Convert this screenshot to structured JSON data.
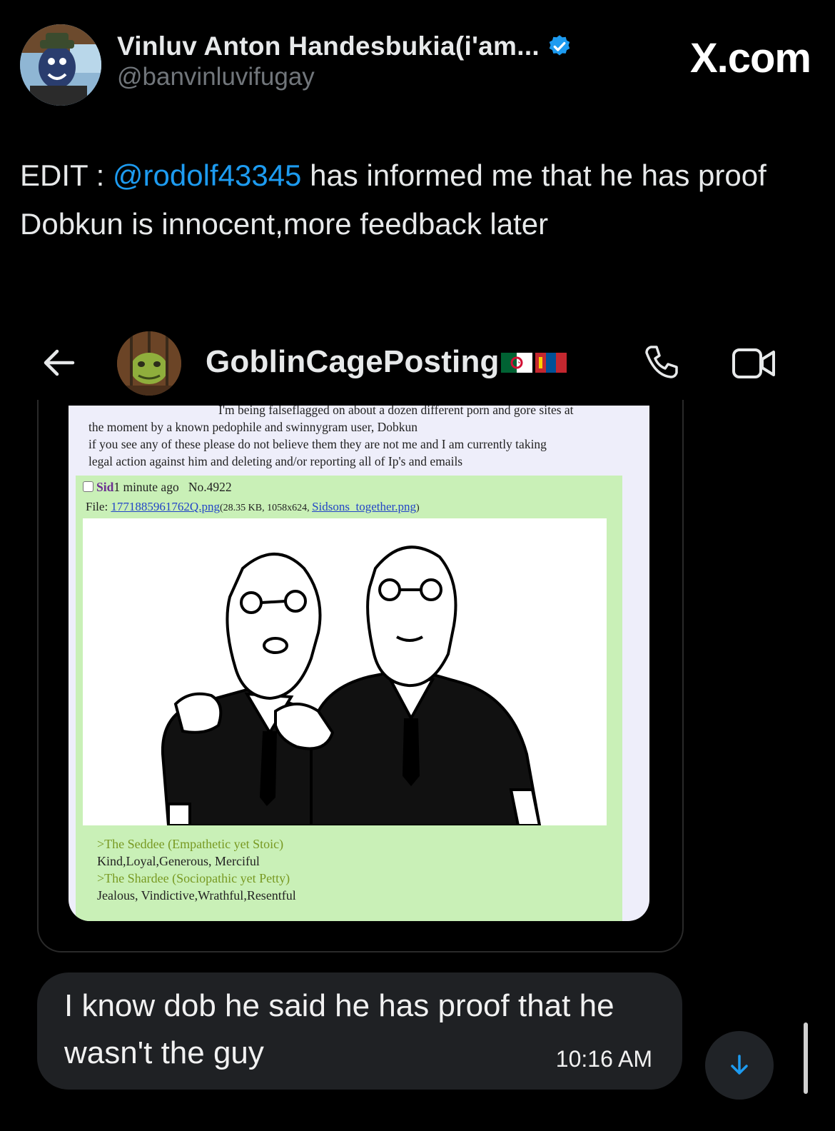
{
  "tweet": {
    "display_name": "Vinluv Anton Handesbukia(i'am...",
    "handle": "@banvinluvifugay",
    "source": "X.com",
    "text_prefix": "EDIT : ",
    "mention": "@rodolf43345",
    "text_suffix": " has informed me that he has proof Dobkun is innocent,more feedback later"
  },
  "chat": {
    "contact_name": "GoblinCagePosting",
    "flags": [
      "algeria-flag",
      "mongolia-flag"
    ],
    "icons": {
      "back": "back-arrow-icon",
      "call": "phone-icon",
      "video": "video-icon",
      "scroll": "arrow-down-icon"
    }
  },
  "screenshot": {
    "op_lines": [
      "I'm being falseflagged on about a dozen different porn and gore sites at",
      "the moment by a known pedophile and swinnygram user, Dobkun",
      "if you see any of these please do not believe them they are not me and I am currently taking",
      "legal action against him and deleting and/or reporting all of Ip's and emails"
    ],
    "reply": {
      "name": "Sid",
      "time": "1 minute ago",
      "number": "No.4922",
      "file_label": "File: ",
      "file_name": "1771885961762Q.png",
      "file_meta": "(28.35 KB, 1058x624, ",
      "original_name": "Sidsons_together.png",
      "file_close": ")",
      "greentext": [
        ">The Seddee (Empathetic yet Stoic)",
        "Kind,Loyal,Generous, Merciful",
        ">The Shardee (Sociopathic yet Petty)",
        "Jealous, Vindictive,Wrathful,Resentful"
      ]
    }
  },
  "message": {
    "text": "I know dob he said he has proof that he wasn't the guy",
    "time": "10:16 AM"
  },
  "colors": {
    "mention": "#1d9bf0",
    "verified": "#1d9bf0",
    "greentext": "#789922",
    "post_bg": "#c9f0b7"
  }
}
